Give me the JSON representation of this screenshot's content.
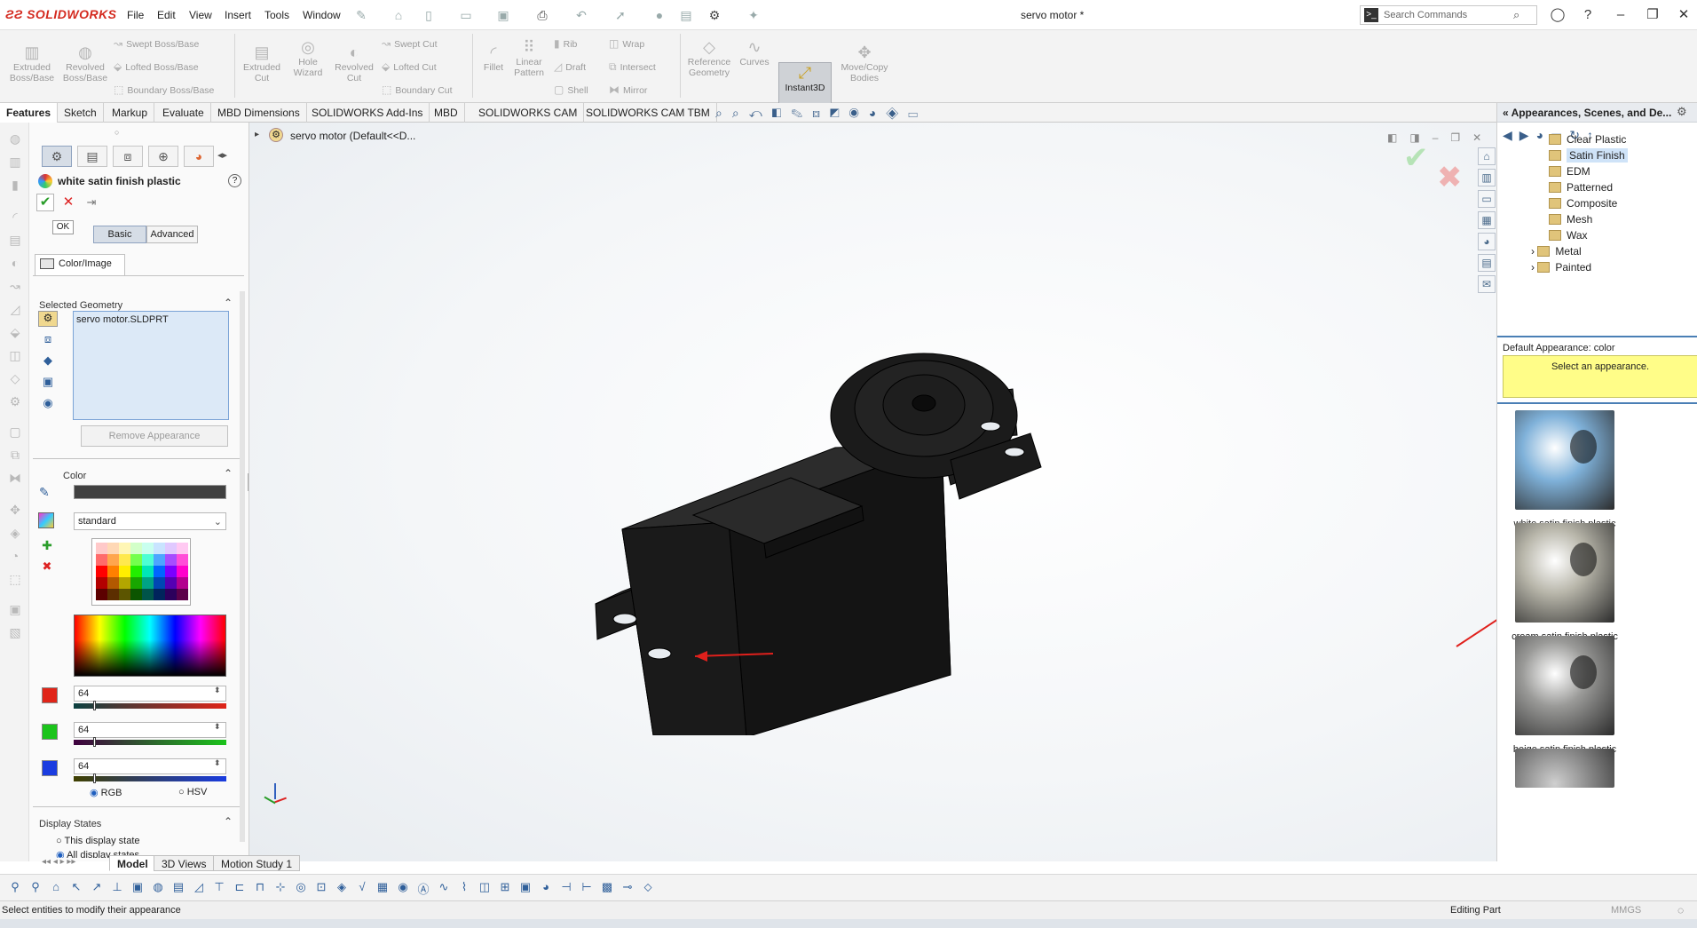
{
  "app": {
    "brand": "SOLIDWORKS",
    "title": "servo motor *"
  },
  "menu": [
    "File",
    "Edit",
    "View",
    "Insert",
    "Tools",
    "Window"
  ],
  "search": {
    "placeholder": "Search Commands"
  },
  "ribbon": {
    "extruded_boss": "Extruded Boss/Base",
    "revolved_boss": "Revolved Boss/Base",
    "swept_boss": "Swept Boss/Base",
    "lofted_boss": "Lofted Boss/Base",
    "boundary_boss": "Boundary Boss/Base",
    "extruded_cut": "Extruded Cut",
    "hole_wizard": "Hole Wizard",
    "revolved_cut": "Revolved Cut",
    "swept_cut": "Swept Cut",
    "lofted_cut": "Lofted Cut",
    "boundary_cut": "Boundary Cut",
    "fillet": "Fillet",
    "linear_pattern": "Linear Pattern",
    "rib": "Rib",
    "draft": "Draft",
    "shell": "Shell",
    "wrap": "Wrap",
    "intersect": "Intersect",
    "mirror": "Mirror",
    "reference_geometry": "Reference Geometry",
    "curves": "Curves",
    "instant3d": "Instant3D",
    "move_copy": "Move/Copy Bodies"
  },
  "tabs": [
    "Features",
    "Sketch",
    "Markup",
    "Evaluate",
    "MBD Dimensions",
    "SOLIDWORKS Add-Ins",
    "MBD",
    "SOLIDWORKS CAM",
    "SOLIDWORKS CAM TBM"
  ],
  "pm": {
    "title": "white satin finish plastic",
    "ok_tooltip": "OK",
    "basic": "Basic",
    "advanced": "Advanced",
    "color_image_tab": "Color/Image",
    "selected_geometry": "Selected Geometry",
    "selected_item": "servo motor.SLDPRT",
    "remove_appearance": "Remove Appearance",
    "color_section": "Color",
    "swatch_dropdown": "standard",
    "r_value": "64",
    "g_value": "64",
    "b_value": "64",
    "rgb_label": "RGB",
    "hsv_label": "HSV",
    "display_states": "Display States",
    "this_display_state": "This display state",
    "all_display_states": "All display states"
  },
  "tree": {
    "root": "servo motor  (Default<<D..."
  },
  "taskpane": {
    "header": "Appearances, Scenes, and De...",
    "items": [
      {
        "label": "Clear Plastic",
        "selected": false
      },
      {
        "label": "Satin Finish",
        "selected": true
      },
      {
        "label": "EDM",
        "selected": false
      },
      {
        "label": "Patterned",
        "selected": false
      },
      {
        "label": "Composite",
        "selected": false
      },
      {
        "label": "Mesh",
        "selected": false
      },
      {
        "label": "Wax",
        "selected": false
      },
      {
        "label": "Metal",
        "selected": false
      },
      {
        "label": "Painted",
        "selected": false
      }
    ],
    "default_appearance": "Default Appearance: color",
    "select_prompt": "Select an appearance.",
    "thumbs": [
      {
        "label": "white satin finish plastic",
        "color": "#7fb1d9"
      },
      {
        "label": "cream satin finish plastic",
        "color": "#b8b6aa"
      },
      {
        "label": "beige satin finish plastic",
        "color": "#9a9a98"
      }
    ]
  },
  "bottom_tabs": [
    "Model",
    "3D Views",
    "Motion Study 1"
  ],
  "status": {
    "left": "Select entities to modify their appearance",
    "mode": "Editing Part",
    "units": "MMGS"
  },
  "colors": {
    "accent_red": "#d42a1f",
    "selection_blue": "#dce9f7",
    "yellow_prompt": "#fffd88",
    "arrow_red": "#e0201c"
  }
}
